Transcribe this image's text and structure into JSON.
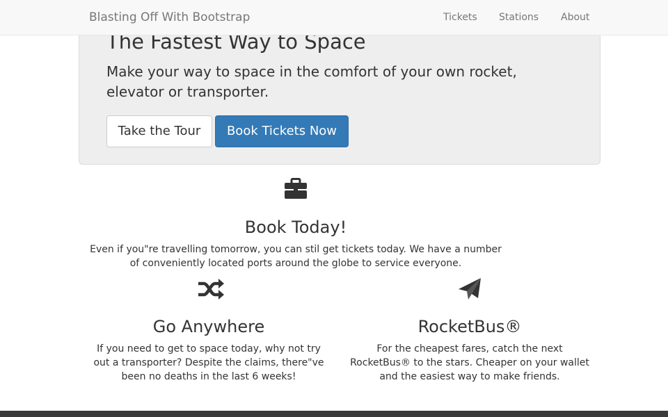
{
  "navbar": {
    "brand": "Blasting Off With Bootstrap",
    "links": [
      {
        "label": "Tickets"
      },
      {
        "label": "Stations"
      },
      {
        "label": "About"
      }
    ]
  },
  "hero": {
    "title": "The Fastest Way to Space",
    "lead": "Make your way to space in the comfort of your own rocket, elevator or transporter.",
    "buttons": {
      "tour": "Take the Tour",
      "book": "Book Tickets Now"
    },
    "primary_color": "#337ab7"
  },
  "features": [
    {
      "icon": "briefcase-icon",
      "title": "Book Today!",
      "text": "Even if you\"re travelling tomorrow, you can stil get tickets today. We have a number of conveniently located ports around the globe to service everyone."
    },
    {
      "icon": "shuffle-icon",
      "title": "Go Anywhere",
      "text": "If you need to get to space today, why not try out a transporter? Despite the claims, there\"ve been no deaths in the last 6 weeks!"
    },
    {
      "icon": "paper-plane-icon",
      "title": "RocketBus®",
      "text": "For the cheapest fares, catch the next RocketBus® to the stars. Cheaper on your wallet and the easiest way to make friends."
    }
  ]
}
